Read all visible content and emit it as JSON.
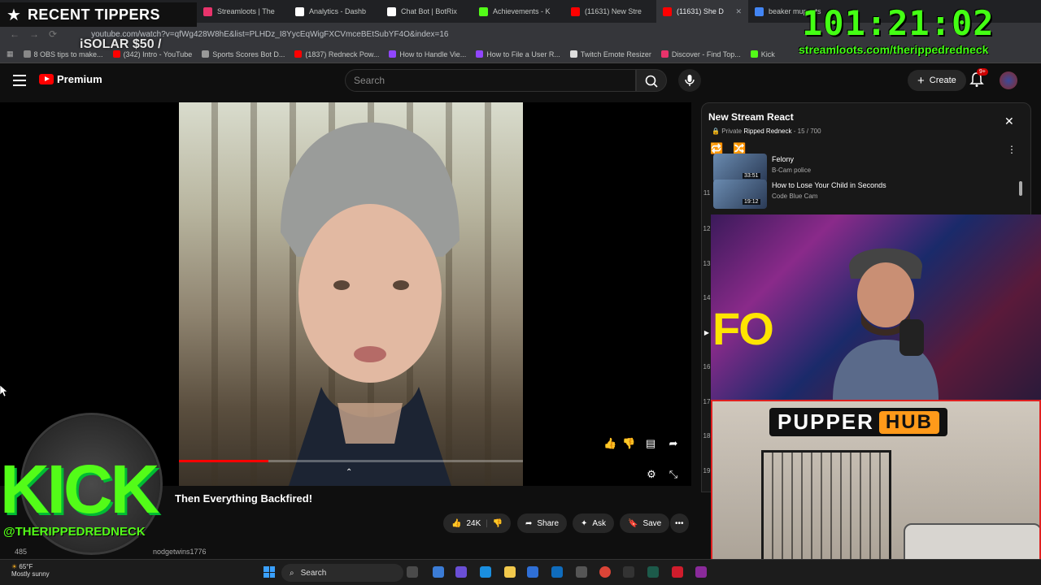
{
  "browser": {
    "tabs": [
      {
        "label": "Streamloots | The",
        "color": "#e8336b",
        "active": false
      },
      {
        "label": "Analytics - Dashb",
        "color": "#ffffff",
        "active": false
      },
      {
        "label": "Chat Bot | BotRix",
        "color": "#ffffff",
        "active": false
      },
      {
        "label": "Achievements - K",
        "color": "#53fc18",
        "active": false
      },
      {
        "label": "(11631) New Stre",
        "color": "#ff0000",
        "active": false
      },
      {
        "label": "(11631) She D",
        "color": "#ff0000",
        "active": true
      },
      {
        "label": "beaker muppets",
        "color": "#4285f4",
        "active": false
      }
    ],
    "url": "youtube.com/watch?v=qfWg428W8hE&list=PLHDz_I8YycEqWigFXCVmceBEtSubYF4O&index=16",
    "bookmarks": [
      {
        "label": "8 OBS tips to make...",
        "color": "#888888"
      },
      {
        "label": "(342) Intro - YouTube",
        "color": "#ff0000"
      },
      {
        "label": "Sports Scores Bot D...",
        "color": "#999999"
      },
      {
        "label": "(1837) Redneck Pow...",
        "color": "#ff0000"
      },
      {
        "label": "How to Handle Vie...",
        "color": "#9146ff"
      },
      {
        "label": "How to File a User R...",
        "color": "#9146ff"
      },
      {
        "label": "Twitch Emote Resizer",
        "color": "#dddddd"
      },
      {
        "label": "Discover - Find Top...",
        "color": "#e8336b"
      },
      {
        "label": "Kick",
        "color": "#53fc18"
      }
    ]
  },
  "youtube": {
    "logo_text": "Premium",
    "search_placeholder": "Search",
    "create_label": "Create",
    "notification_count": "9+",
    "video_title": "Then Everything Backfired!",
    "likes": "24K",
    "share_label": "Share",
    "ask_label": "Ask",
    "save_label": "Save",
    "channel": "nodgetwins1776",
    "subs_partial": "485",
    "progress_fraction": 0.26
  },
  "playlist": {
    "title": "New Stream React",
    "privacy": "Private",
    "owner": "Ripped Redneck",
    "position": "15 / 700",
    "items": [
      {
        "title": "Felony",
        "channel": "B-Cam police",
        "duration": "33:51",
        "num": ""
      },
      {
        "title": "How to Lose Your Child in Seconds",
        "channel": "Code Blue Cam",
        "duration": "19:12",
        "num": "11"
      }
    ],
    "side_numbers": [
      "12",
      "13",
      "14",
      "",
      "16",
      "17",
      "18",
      "19"
    ]
  },
  "overlays": {
    "recent_tippers": "RECENT TIPPERS",
    "solar": "iSOLAR $50 /",
    "timer": "101:21:02",
    "streamloots_url": "streamloots.com/therippedredneck",
    "kick_word": "KICK",
    "kick_handle": "@THERIPPEDREDNECK",
    "pupper_word1": "PUPPER",
    "pupper_word2": "HUB",
    "cam_text": "FO"
  },
  "taskbar": {
    "temperature": "65°F",
    "weather": "Mostly sunny",
    "search": "Search"
  }
}
